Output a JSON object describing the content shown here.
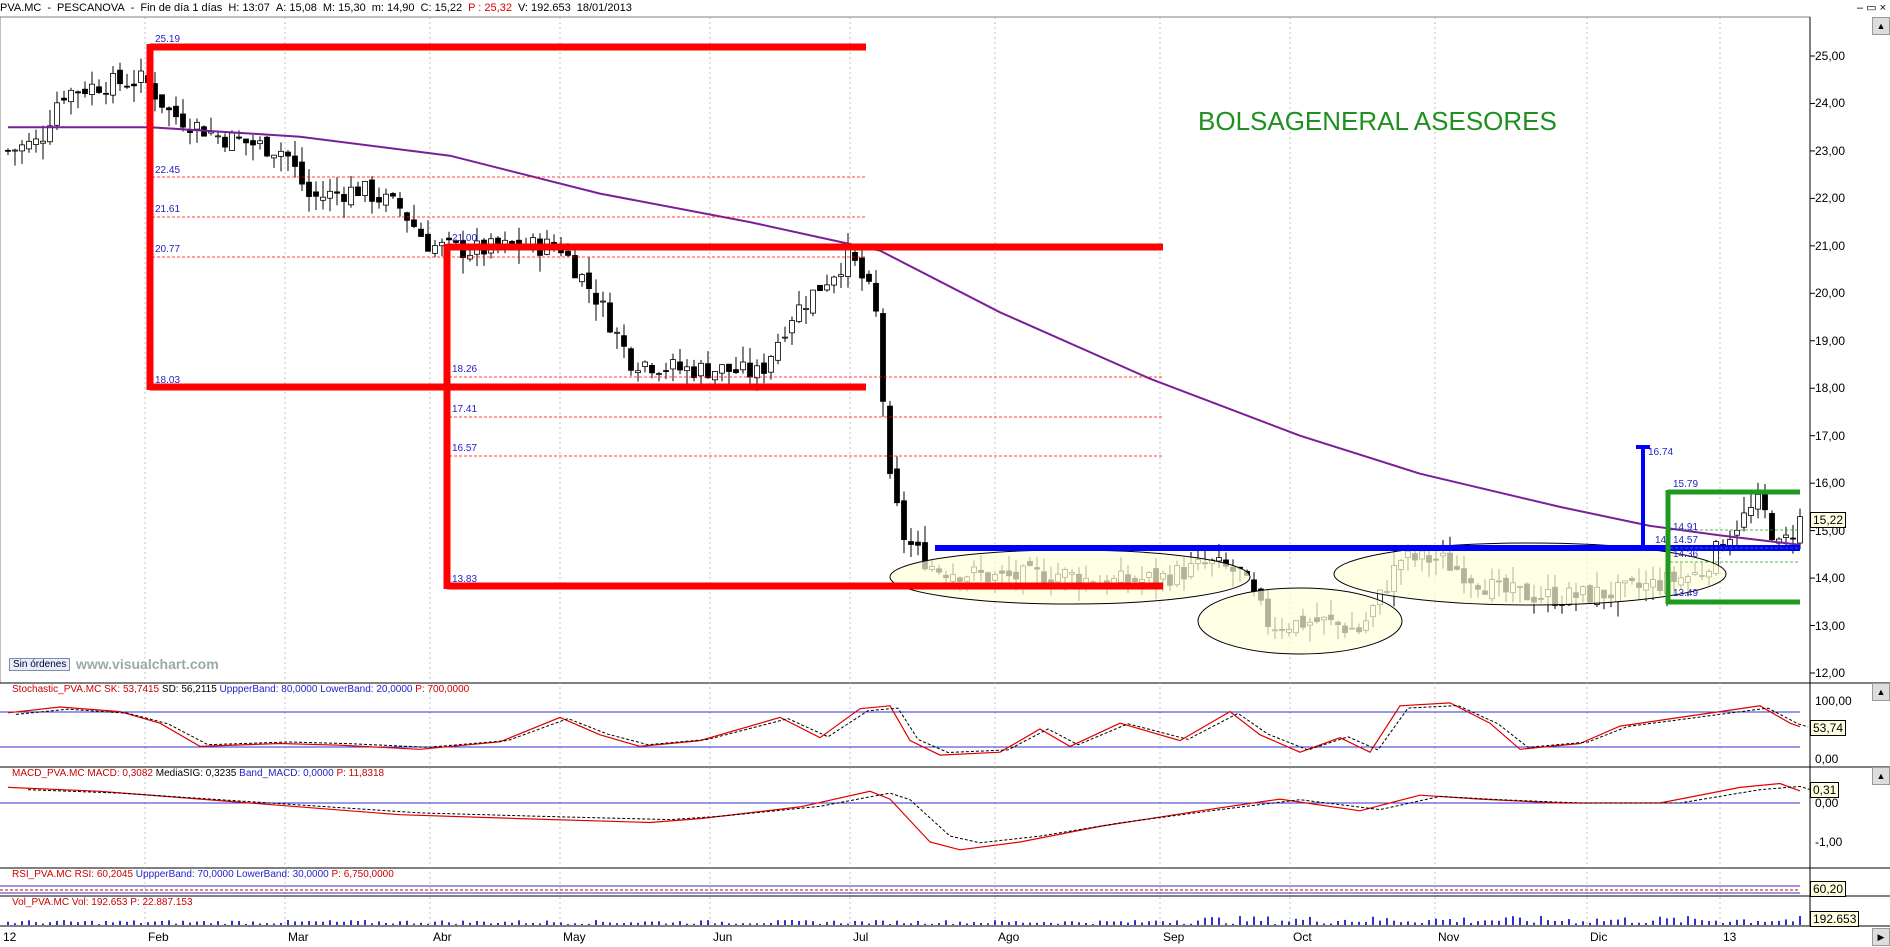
{
  "title_bar": {
    "symbol": "PVA.MC",
    "name": "PESCANOVA",
    "period": "Fin de día 1 días",
    "time": "H: 13:07",
    "open": "A: 15,08",
    "high": "M: 15,30",
    "low": "m: 14,90",
    "close": "C: 15,22",
    "pct": "P : 25,32",
    "volume": "V: 192.653",
    "date": "18/01/2013"
  },
  "window_buttons": "–  ▭  ×",
  "brand_text": "BOLSAGENERAL ASESORES",
  "watermark": "www.visualchart.com",
  "sin_ordenes": "Sin órdenes",
  "price_axis": [
    "25,00",
    "24,00",
    "23,00",
    "22,00",
    "21,00",
    "20,00",
    "19,00",
    "18,00",
    "17,00",
    "16,00",
    "15,00",
    "14,00",
    "13,00",
    "12,00"
  ],
  "last_price": "15,22",
  "x_axis": [
    "12",
    "Feb",
    "Mar",
    "Abr",
    "May",
    "Jun",
    "Jul",
    "Ago",
    "Sep",
    "Oct",
    "Nov",
    "Dic",
    "13"
  ],
  "levels": {
    "box1_top": "25.19",
    "box1_bottom": "18.03",
    "fib1": "22.45",
    "fib2": "21.61",
    "fib3": "20.77",
    "box2_top": "21.00",
    "box2_bottom": "13.83",
    "fib4": "18.26",
    "fib5": "17.41",
    "fib6": "16.57",
    "target": "16.74",
    "box3_top": "15.79",
    "box3_bottom": "13.49",
    "small1": "14.91",
    "small2": "14",
    "small3": "14.57",
    "small4": "14.36"
  },
  "stoch": {
    "label_name": "Stochastic_PVA.MC",
    "label_sk": "SK: 53,7415",
    "label_sd": "SD: 56,2115",
    "label_upper": "UppperBand: 80,0000",
    "label_lower": "LowerBand: 20,0000",
    "label_p": "P: 700,0000",
    "axis": [
      "100,00",
      "0,00"
    ],
    "last": "53,74"
  },
  "macd": {
    "label_name": "MACD_PVA.MC",
    "label_macd": "MACD: 0,3082",
    "label_sig": "MediaSIG: 0,3235",
    "label_band": "Band_MACD: 0,0000",
    "label_p": "P: 11,8318",
    "axis": [
      "0,00",
      "-1,00"
    ],
    "last": "0,31"
  },
  "rsi": {
    "label_name": "RSI_PVA.MC",
    "label_rsi": "RSI: 60,2045",
    "label_upper": "UppperBand: 70,0000",
    "label_lower": "LowerBand: 30,0000",
    "label_p": "P: 6,750,0000",
    "last": "60,20"
  },
  "vol": {
    "label_name": "Vol_PVA.MC",
    "label_vol": "Vol: 192.653",
    "label_p": "P: 22.887.153",
    "last": "192.653"
  },
  "chart_data": {
    "type": "candlestick",
    "title": "PVA.MC - PESCANOVA",
    "ylim": [
      12,
      25.5
    ],
    "moving_average_color": "#7a1e9a",
    "colors": {
      "levels": "#ff0000",
      "support": "#0000ff",
      "box3": "#1f9a1f",
      "candle": "#000000"
    },
    "series_close_approx": [
      {
        "date": "2012-01",
        "close": 23.0
      },
      {
        "date": "2012-02-01",
        "close": 24.2
      },
      {
        "date": "2012-02-15",
        "close": 23.6
      },
      {
        "date": "2012-03-01",
        "close": 23.0
      },
      {
        "date": "2012-03-15",
        "close": 22.2
      },
      {
        "date": "2012-04-01",
        "close": 21.0
      },
      {
        "date": "2012-04-15",
        "close": 20.8
      },
      {
        "date": "2012-05-01",
        "close": 21.0
      },
      {
        "date": "2012-05-15",
        "close": 19.0
      },
      {
        "date": "2012-06-01",
        "close": 18.5
      },
      {
        "date": "2012-06-15",
        "close": 18.4
      },
      {
        "date": "2012-07-01",
        "close": 20.5
      },
      {
        "date": "2012-07-15",
        "close": 14.8
      },
      {
        "date": "2012-08-01",
        "close": 14.2
      },
      {
        "date": "2012-08-15",
        "close": 14.0
      },
      {
        "date": "2012-09-01",
        "close": 14.0
      },
      {
        "date": "2012-09-15",
        "close": 14.3
      },
      {
        "date": "2012-10-01",
        "close": 13.2
      },
      {
        "date": "2012-10-15",
        "close": 12.9
      },
      {
        "date": "2012-11-01",
        "close": 14.4
      },
      {
        "date": "2012-11-15",
        "close": 13.7
      },
      {
        "date": "2012-12-01",
        "close": 13.6
      },
      {
        "date": "2012-12-15",
        "close": 13.9
      },
      {
        "date": "2013-01-07",
        "close": 15.4
      },
      {
        "date": "2013-01-18",
        "close": 15.22
      }
    ]
  }
}
